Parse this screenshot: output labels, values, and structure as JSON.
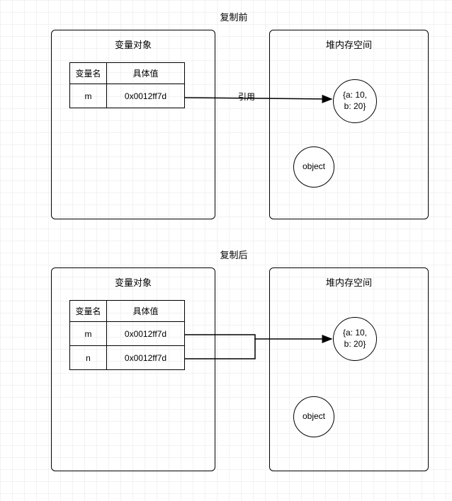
{
  "sections": {
    "before": {
      "title": "复制前"
    },
    "after": {
      "title": "复制后"
    }
  },
  "panels": {
    "varobj_title": "变量对象",
    "heap_title": "堆内存空间"
  },
  "table": {
    "header_name": "变量名",
    "header_value": "具体值",
    "rows_before": [
      {
        "name": "m",
        "value": "0x0012ff7d"
      }
    ],
    "rows_after": [
      {
        "name": "m",
        "value": "0x0012ff7d"
      },
      {
        "name": "n",
        "value": "0x0012ff7d"
      }
    ]
  },
  "heap": {
    "obj_content": "{a: 10,\nb: 20}",
    "obj_label": "object"
  },
  "edge": {
    "ref_label": "引用"
  }
}
